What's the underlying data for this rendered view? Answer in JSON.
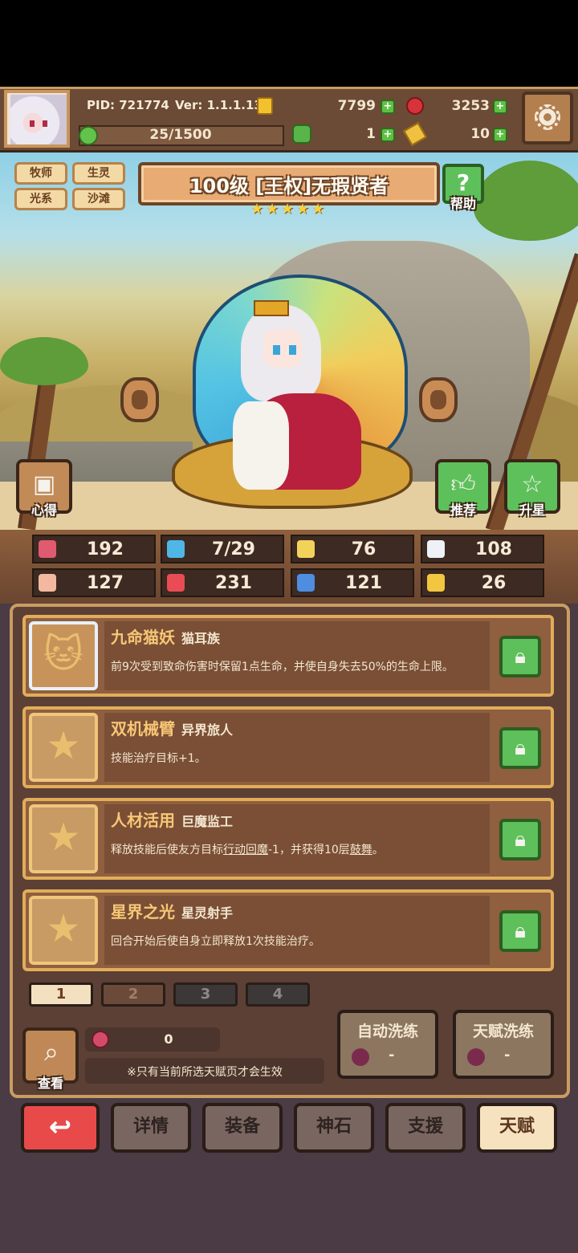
{
  "header": {
    "pid": "PID: 721774",
    "version": "Ver: 1.1.1.13",
    "gold": "7799",
    "gems": "3253",
    "stamina": "25/1500",
    "clover": "1",
    "keys": "10"
  },
  "hero": {
    "tags": [
      "牧师",
      "生灵",
      "光系",
      "沙滩"
    ],
    "title": "100级  [王权]无瑕贤者",
    "star_count": 5,
    "help_label": "帮助",
    "heart_label": "心得",
    "recommend_label": "推荐",
    "upgrade_label": "升星"
  },
  "stats": [
    {
      "icon": "heart-icon",
      "value": "192",
      "color": "#e05a70"
    },
    {
      "icon": "water-drop-icon",
      "value": "7/29",
      "color": "#4fb7e6"
    },
    {
      "icon": "shield-icon",
      "value": "76",
      "color": "#f1d35c"
    },
    {
      "icon": "wing-icon",
      "value": "108",
      "color": "#eef2f6"
    },
    {
      "icon": "fist-icon",
      "value": "127",
      "color": "#f3b9a0"
    },
    {
      "icon": "book-icon",
      "value": "231",
      "color": "#e94c54"
    },
    {
      "icon": "scroll-icon",
      "value": "121",
      "color": "#4f8de0"
    },
    {
      "icon": "horseshoe-icon",
      "value": "26",
      "color": "#f3c640"
    }
  ],
  "talents": [
    {
      "name": "九命猫妖",
      "sub": "猫耳族",
      "desc": "前9次受到致命伤害时保留1点生命，并使自身失去50%的生命上限。"
    },
    {
      "name": "双机械臂",
      "sub": "异界旅人",
      "desc": "技能治疗目标+1。"
    },
    {
      "name": "人材活用",
      "sub": "巨魔监工",
      "desc_parts": [
        "释放技能后使友方目标",
        "行动回魔",
        "-1，并获得10层",
        "鼓舞",
        "。"
      ]
    },
    {
      "name": "星界之光",
      "sub": "星灵射手",
      "desc": "回合开始后使自身立即释放1次技能治疗。"
    }
  ],
  "pages": [
    "1",
    "2",
    "3",
    "4"
  ],
  "controls": {
    "view_label": "查看",
    "fruit_count": "0",
    "note": "※只有当前所选天赋页才会生效",
    "auto_wash": "自动洗练",
    "talent_wash": "天赋洗练",
    "wash_cost": "-"
  },
  "nav": [
    "详情",
    "装备",
    "神石",
    "支援",
    "天赋"
  ],
  "colors": {
    "accent": "#e1ad5a",
    "green": "#5ec05a",
    "red": "#e84a4a"
  }
}
